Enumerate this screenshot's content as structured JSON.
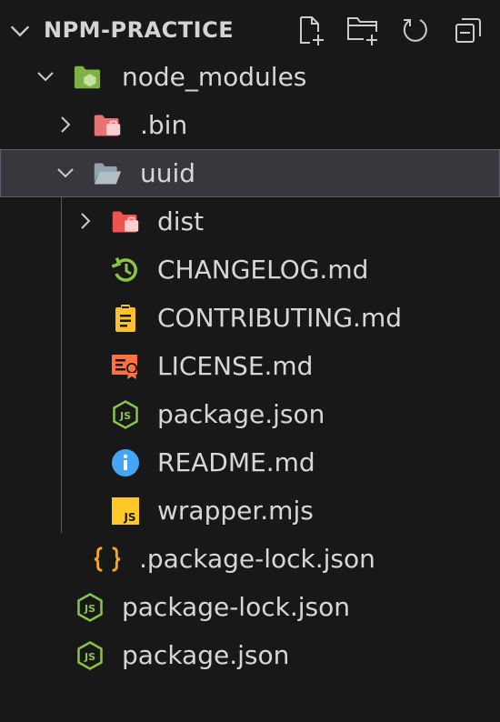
{
  "explorer": {
    "title": "NPM-PRACTICE",
    "actions": [
      {
        "name": "new-file",
        "icon": "new-file-icon"
      },
      {
        "name": "new-folder",
        "icon": "new-folder-icon"
      },
      {
        "name": "refresh",
        "icon": "refresh-icon"
      },
      {
        "name": "collapse-all",
        "icon": "collapse-all-icon"
      }
    ]
  },
  "tree": [
    {
      "label": "node_modules",
      "icon": "node-modules-folder-icon",
      "expanded": true
    },
    {
      "label": ".bin",
      "icon": "bin-folder-icon",
      "expanded": false
    },
    {
      "label": "uuid",
      "icon": "folder-open-icon",
      "expanded": true,
      "selected": true
    },
    {
      "label": "dist",
      "icon": "dist-folder-icon",
      "expanded": false
    },
    {
      "label": "CHANGELOG.md",
      "icon": "changelog-icon"
    },
    {
      "label": "CONTRIBUTING.md",
      "icon": "contributing-icon"
    },
    {
      "label": "LICENSE.md",
      "icon": "license-icon"
    },
    {
      "label": "package.json",
      "icon": "nodejs-icon"
    },
    {
      "label": "README.md",
      "icon": "readme-info-icon"
    },
    {
      "label": "wrapper.mjs",
      "icon": "javascript-icon"
    },
    {
      "label": ".package-lock.json",
      "icon": "json-braces-icon"
    },
    {
      "label": "package-lock.json",
      "icon": "nodejs-icon"
    },
    {
      "label": "package.json",
      "icon": "nodejs-icon"
    }
  ],
  "colors": {
    "background": "#181818",
    "selection": "#37373d",
    "node_green": "#8bc34a",
    "folder_red": "#ef5350",
    "json_orange": "#f9a825",
    "js_yellow": "#ffca28",
    "license_orange": "#ff7043",
    "info_blue": "#42a5f5"
  }
}
